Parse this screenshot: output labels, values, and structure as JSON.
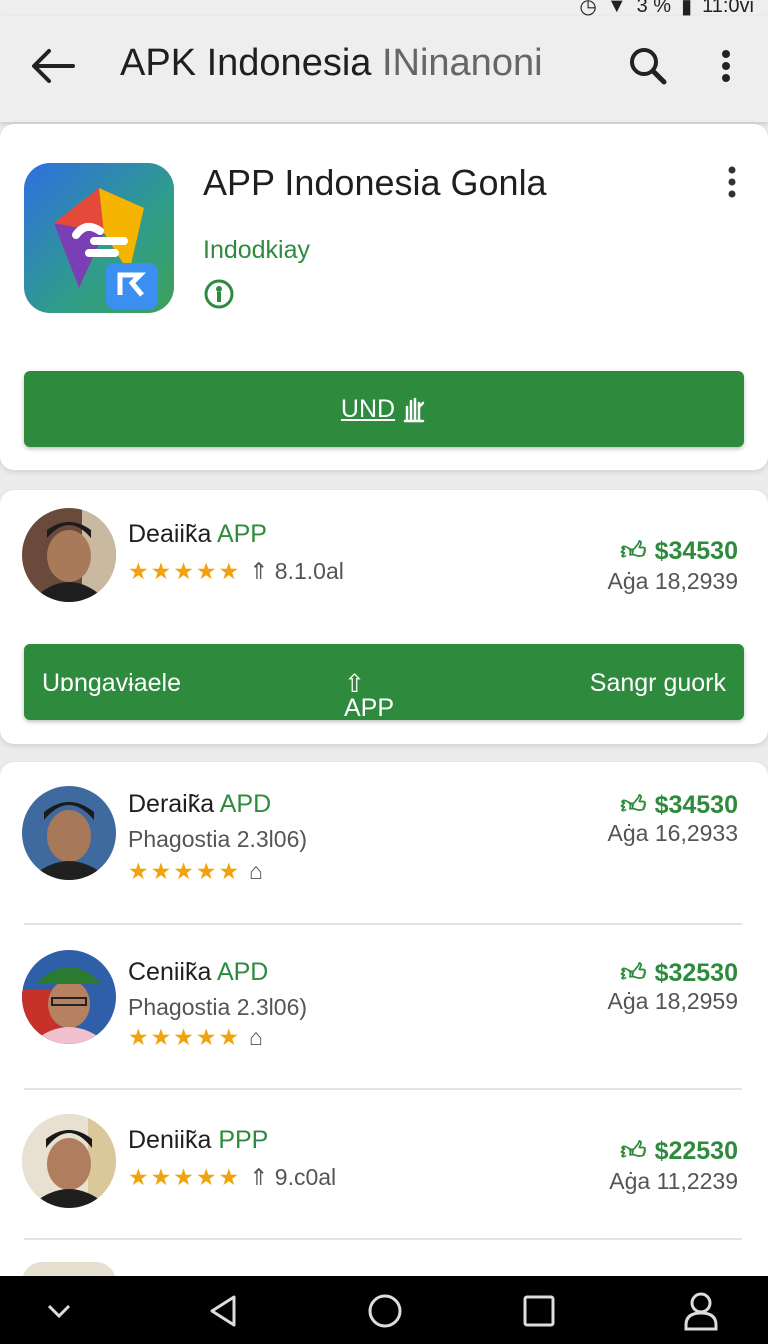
{
  "status": {
    "battery": "3 %",
    "time": "11:0vi"
  },
  "appbar": {
    "title": "APK Indonesia",
    "subtitle": "INinanoni"
  },
  "hero": {
    "title": "APP Indonesia Gonla",
    "developer": "Indodkiay",
    "install_label": "UND"
  },
  "featured": {
    "name": "Deaiik̃a",
    "tag": "APP",
    "rating_meta": "8.1.0al",
    "price": "$34530",
    "downloads": "Aġa 18,2939",
    "action_left": "Uɒngavɨaele",
    "action_center": "APP",
    "action_right": "Sangr guork"
  },
  "list": [
    {
      "name": "Deraik̃a",
      "tag": "APD",
      "subtitle": "Phagostia 2.3l06)",
      "price": "$34530",
      "downloads": "Aġa 16,2933"
    },
    {
      "name": "Ceniik̃a",
      "tag": "APD",
      "subtitle": "Phagostia 2.3l06)",
      "price": "$32530",
      "downloads": "Aġa 18,2959"
    },
    {
      "name": "Deniik̃a",
      "tag": "PPP",
      "rating_meta": "9.c0al",
      "price": "$22530",
      "downloads": "Aġa 11,2239"
    }
  ],
  "colors": {
    "accent": "#2e8b3e",
    "star": "#f2a20b",
    "background": "#ececec"
  }
}
